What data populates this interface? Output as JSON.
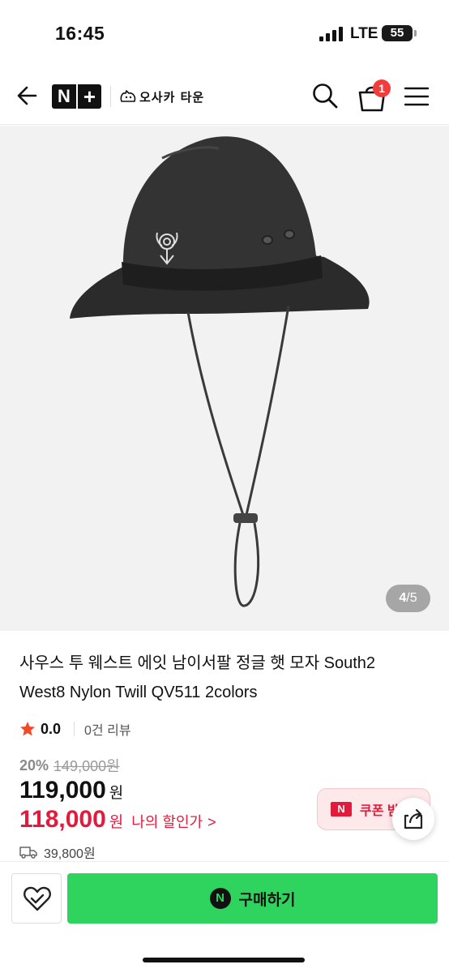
{
  "status_bar": {
    "time": "16:45",
    "network": "LTE",
    "battery": "55"
  },
  "header": {
    "logo": {
      "n": "N",
      "plus": "+"
    },
    "store_name": "오사카 타운",
    "cart_count": "1"
  },
  "gallery": {
    "current": "4",
    "separator": "/",
    "total": "5"
  },
  "product": {
    "title": "사우스 투 웨스트 에잇 남이서팔 정글 햇 모자 South2 West8 Nylon Twill QV511 2colors",
    "rating": "0.0",
    "review_count": "0건 리뷰",
    "discount_rate": "20%",
    "original_price": "149,000원",
    "sale_price": "119,000",
    "currency": "원",
    "my_price": "118,000",
    "my_price_label": "나의 할인가",
    "my_price_chevron": ">",
    "coupon_mark": "N",
    "coupon_label": "쿠폰 받기",
    "shipping_fee": "39,800원"
  },
  "actions": {
    "buy_icon": "N",
    "buy_label": "구매하기"
  },
  "colors": {
    "accent_green": "#2fd45e",
    "sale_red": "#e21b3c",
    "badge_red": "#f23b3b",
    "star": "#f04a2a"
  }
}
